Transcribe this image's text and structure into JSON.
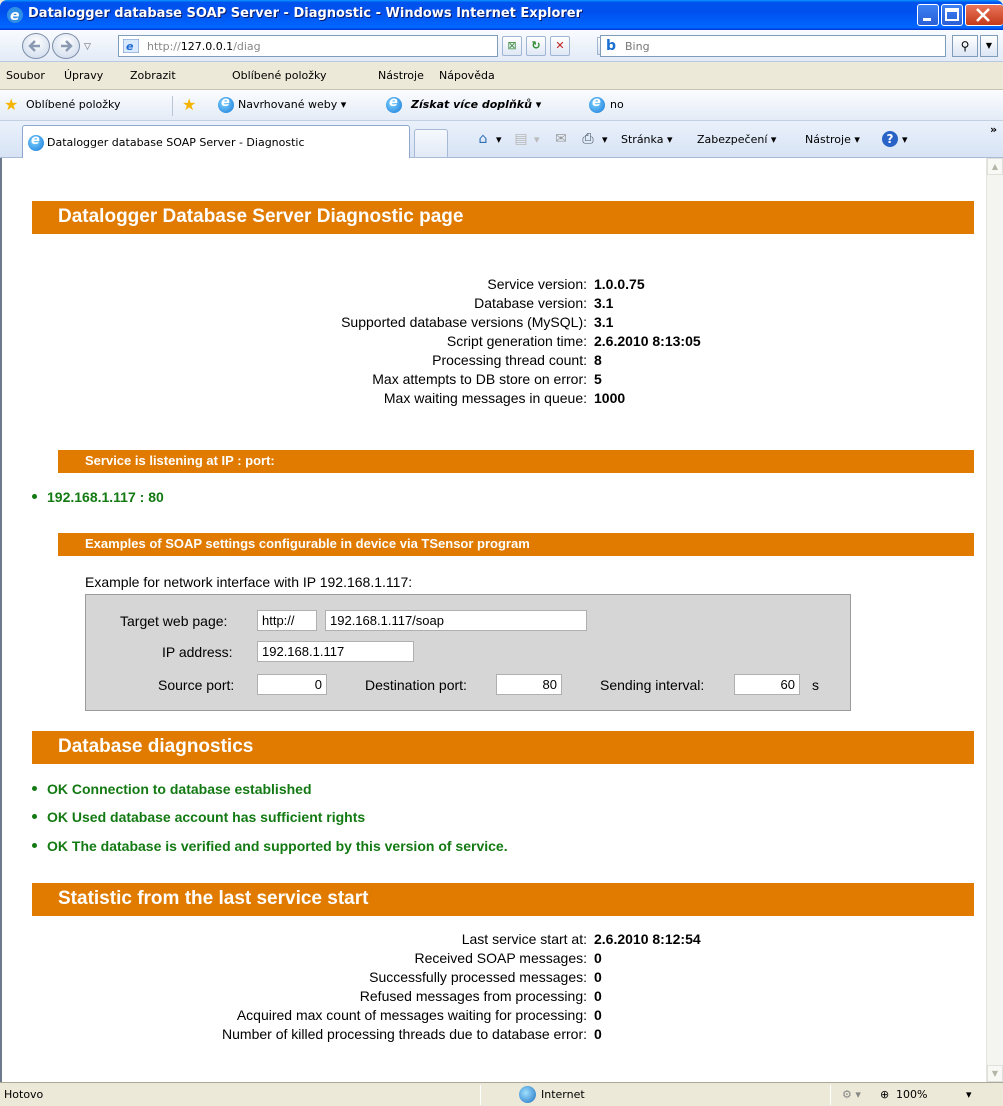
{
  "window": {
    "title": "Datalogger database SOAP Server - Diagnostic - Windows Internet Explorer"
  },
  "address": {
    "url_prefix": "http://",
    "url_host": "127.0.0.1",
    "url_path": "/diag",
    "search_placeholder": "Bing"
  },
  "menu": [
    "Soubor",
    "Úpravy",
    "Zobrazit",
    "Oblíbené položky",
    "Nástroje",
    "Nápověda"
  ],
  "favorites": {
    "label": "Oblíbené položky",
    "suggested": "Navrhované weby ▾",
    "addons": "Získat více doplňků ▾",
    "no": "no"
  },
  "tab": {
    "label": "Datalogger database SOAP Server - Diagnostic"
  },
  "commands": {
    "page": "Stránka ▾",
    "security": "Zabezpečení ▾",
    "tools": "Nástroje ▾",
    "more": "»"
  },
  "page": {
    "main_title": "Datalogger Database Server Diagnostic page",
    "service_info": [
      {
        "label": "Service version:",
        "value": "1.0.0.75"
      },
      {
        "label": "Database version:",
        "value": "3.1"
      },
      {
        "label": "Supported database versions (MySQL):",
        "value": "3.1"
      },
      {
        "label": "Script generation time:",
        "value": "2.6.2010 8:13:05"
      },
      {
        "label": "Processing thread count:",
        "value": "8"
      },
      {
        "label": "Max attempts to DB store on error:",
        "value": "5"
      },
      {
        "label": "Max waiting messages in queue:",
        "value": "1000"
      }
    ],
    "listening_title": "Service is listening at IP : port:",
    "listening_items": [
      "192.168.1.117 : 80"
    ],
    "examples_title": "Examples of SOAP settings configurable in device via TSensor program",
    "example_caption": "Example for network interface with IP 192.168.1.117:",
    "example": {
      "target_label": "Target web page:",
      "target_prefix": "http://",
      "target_value": "192.168.1.117/soap",
      "ip_label": "IP address:",
      "ip_value": "192.168.1.117",
      "source_port_label": "Source port:",
      "source_port_value": "0",
      "dest_port_label": "Destination port:",
      "dest_port_value": "80",
      "interval_label": "Sending interval:",
      "interval_value": "60",
      "interval_unit": "s"
    },
    "db_title": "Database diagnostics",
    "db_items": [
      "OK Connection to database established",
      "OK Used database account has sufficient rights",
      "OK The database is verified and supported by this version of service."
    ],
    "stats_title": "Statistic from the last service start",
    "stats": [
      {
        "label": "Last service start at:",
        "value": "2.6.2010 8:12:54"
      },
      {
        "label": "Received SOAP messages:",
        "value": "0"
      },
      {
        "label": "Successfully processed messages:",
        "value": "0"
      },
      {
        "label": "Refused messages from processing:",
        "value": "0"
      },
      {
        "label": "Acquired max count of messages waiting for processing:",
        "value": "0"
      },
      {
        "label": "Number of killed processing threads due to database error:",
        "value": "0"
      }
    ]
  },
  "status": {
    "text": "Hotovo",
    "zone": "Internet",
    "zoom": "100%"
  }
}
